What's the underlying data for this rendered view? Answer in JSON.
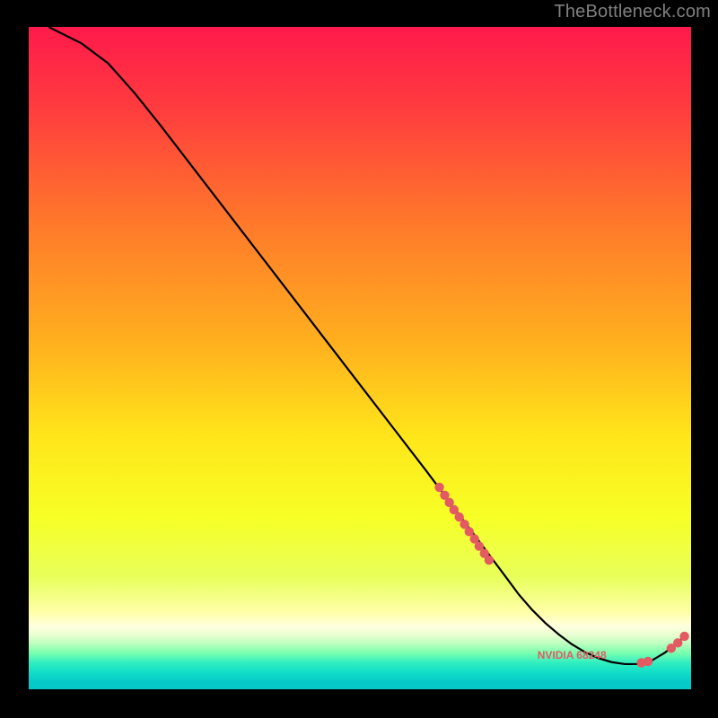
{
  "watermark": "TheBottleneck.com",
  "chart_data": {
    "type": "line",
    "title": "",
    "xlabel": "",
    "ylabel": "",
    "xlim": [
      0,
      100
    ],
    "ylim": [
      0,
      100
    ],
    "grid": false,
    "series": [
      {
        "name": "curve",
        "color": "#000000",
        "x": [
          3,
          5,
          8,
          12,
          16,
          20,
          25,
          30,
          35,
          40,
          45,
          50,
          55,
          60,
          63,
          66,
          69,
          72,
          74,
          76,
          78,
          80,
          82,
          84,
          86,
          88,
          90,
          92,
          94,
          96,
          97.5,
          99
        ],
        "y": [
          100,
          99,
          97.5,
          94.5,
          90,
          85,
          78.5,
          72,
          65.5,
          59,
          52.5,
          46,
          39.5,
          33,
          29,
          25,
          21,
          17,
          14.3,
          12,
          10,
          8.3,
          6.8,
          5.6,
          4.7,
          4.1,
          3.8,
          3.8,
          4.3,
          5.5,
          6.6,
          8
        ]
      }
    ],
    "scatter": [
      {
        "name": "segment-dots",
        "color": "#e35a63",
        "points": [
          {
            "x": 62,
            "y": 30.5
          },
          {
            "x": 62.8,
            "y": 29.3
          },
          {
            "x": 63.5,
            "y": 28.2
          },
          {
            "x": 64.2,
            "y": 27.1
          },
          {
            "x": 65,
            "y": 26
          },
          {
            "x": 65.8,
            "y": 24.9
          },
          {
            "x": 66.5,
            "y": 23.8
          },
          {
            "x": 67.3,
            "y": 22.7
          },
          {
            "x": 68,
            "y": 21.6
          },
          {
            "x": 68.8,
            "y": 20.5
          },
          {
            "x": 69.5,
            "y": 19.5
          },
          {
            "x": 92.5,
            "y": 4.0
          },
          {
            "x": 93.5,
            "y": 4.2
          },
          {
            "x": 97,
            "y": 6.2
          },
          {
            "x": 98,
            "y": 7.0
          },
          {
            "x": 99,
            "y": 8.0
          }
        ]
      }
    ],
    "bottom_label": {
      "text": "NVIDIA 68248",
      "color": "#e35a63",
      "approx_x": 82
    },
    "background_gradient": {
      "stops": [
        {
          "pos": 0.0,
          "color": "#ff1a4b"
        },
        {
          "pos": 0.12,
          "color": "#ff3b3f"
        },
        {
          "pos": 0.3,
          "color": "#ff7a2a"
        },
        {
          "pos": 0.48,
          "color": "#ffb11e"
        },
        {
          "pos": 0.62,
          "color": "#ffe61a"
        },
        {
          "pos": 0.74,
          "color": "#f7ff26"
        },
        {
          "pos": 0.83,
          "color": "#e8ff5a"
        },
        {
          "pos": 0.885,
          "color": "#ffffaa"
        },
        {
          "pos": 0.905,
          "color": "#ffffe0"
        },
        {
          "pos": 0.918,
          "color": "#e8ffd0"
        },
        {
          "pos": 0.93,
          "color": "#c0ffc0"
        },
        {
          "pos": 0.945,
          "color": "#7affb0"
        },
        {
          "pos": 0.96,
          "color": "#30eec0"
        },
        {
          "pos": 0.975,
          "color": "#10ddc8"
        },
        {
          "pos": 0.99,
          "color": "#05c8c8"
        },
        {
          "pos": 1.0,
          "color": "#05c8c8"
        }
      ]
    }
  }
}
